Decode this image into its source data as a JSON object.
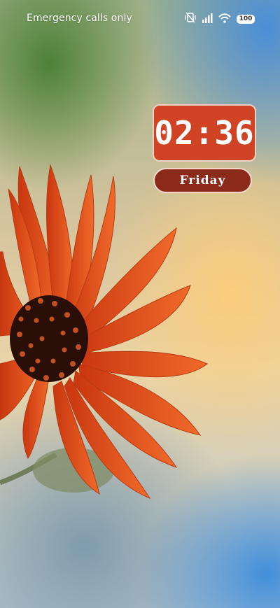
{
  "status_bar": {
    "carrier_text": "Emergency calls only",
    "icons": [
      "vibrate-off-icon",
      "signal-icon",
      "wifi-icon",
      "battery-icon"
    ],
    "battery_level": "100"
  },
  "lock_screen": {
    "clock": {
      "time": "02:36"
    },
    "day": {
      "label": "Friday"
    }
  },
  "wallpaper": {
    "subject": "orange-daisy-flower",
    "colors": {
      "petal": "#e8501c",
      "center": "#2a0f08",
      "widget": "#d04324",
      "pill": "#8c2a19"
    }
  }
}
